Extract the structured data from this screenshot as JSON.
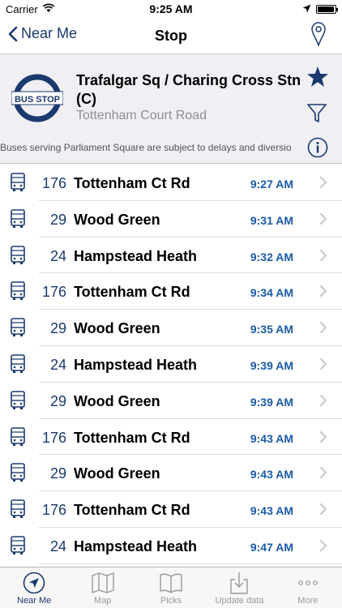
{
  "status_bar": {
    "carrier": "Carrier",
    "time": "9:25 AM",
    "battery_level": 0.95
  },
  "nav": {
    "back_label": "Near Me",
    "title": "Stop"
  },
  "stop": {
    "roundel_text": "BUS STOP",
    "name": "Trafalgar Sq / Charing Cross Stn (C)",
    "road": "Tottenham Court Road",
    "alert": "Buses serving Parliament Square are subject to delays and diversio"
  },
  "departures": [
    {
      "route": "176",
      "destination": "Tottenham Ct Rd",
      "time": "9:27 AM"
    },
    {
      "route": "29",
      "destination": "Wood Green",
      "time": "9:31 AM"
    },
    {
      "route": "24",
      "destination": "Hampstead Heath",
      "time": "9:32 AM"
    },
    {
      "route": "176",
      "destination": "Tottenham Ct Rd",
      "time": "9:34 AM"
    },
    {
      "route": "29",
      "destination": "Wood Green",
      "time": "9:35 AM"
    },
    {
      "route": "24",
      "destination": "Hampstead Heath",
      "time": "9:39 AM"
    },
    {
      "route": "29",
      "destination": "Wood Green",
      "time": "9:39 AM"
    },
    {
      "route": "176",
      "destination": "Tottenham Ct Rd",
      "time": "9:43 AM"
    },
    {
      "route": "29",
      "destination": "Wood Green",
      "time": "9:43 AM"
    },
    {
      "route": "176",
      "destination": "Tottenham Ct Rd",
      "time": "9:43 AM"
    },
    {
      "route": "24",
      "destination": "Hampstead Heath",
      "time": "9:47 AM"
    }
  ],
  "tabs": [
    {
      "label": "Near Me",
      "icon": "navigation-arrow-icon",
      "active": true
    },
    {
      "label": "Map",
      "icon": "map-icon",
      "active": false
    },
    {
      "label": "Picks",
      "icon": "book-icon",
      "active": false
    },
    {
      "label": "Update data",
      "icon": "download-icon",
      "active": false
    },
    {
      "label": "More",
      "icon": "more-dots-icon",
      "active": false
    }
  ],
  "colors": {
    "accent": "#1a3a6e",
    "time": "#1a5aa8",
    "header_bg": "#efeff4"
  }
}
